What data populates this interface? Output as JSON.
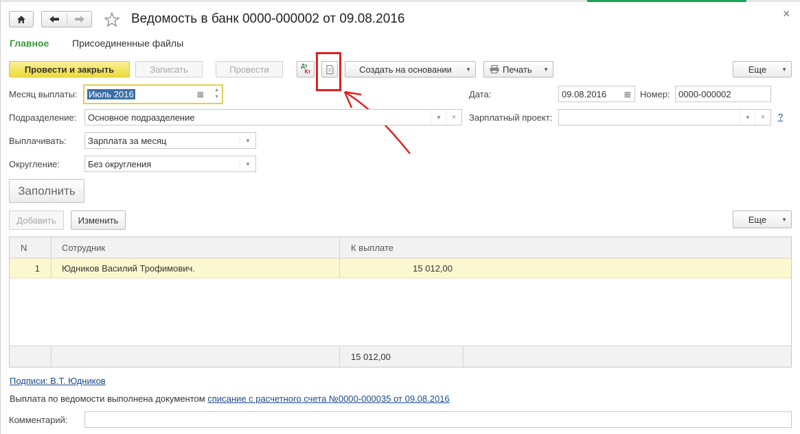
{
  "window": {
    "title": "Ведомость в банк 0000-000002 от 09.08.2016",
    "close_icon": "×"
  },
  "nav": {
    "home_icon": "home-icon",
    "back_icon": "arrow-left-icon",
    "forward_icon": "arrow-right-icon",
    "favorite_icon": "star-icon"
  },
  "tabs": {
    "main": "Главное",
    "files": "Присоединенные файлы"
  },
  "toolbar": {
    "post_close": "Провести и закрыть",
    "save": "Записать",
    "post": "Провести",
    "dtkt_top": "Дт",
    "dtkt_bottom": "Кт",
    "create_based": "Создать на основании",
    "print": "Печать",
    "more": "Еще"
  },
  "form": {
    "month_label": "Месяц выплаты:",
    "month_value": "Июль 2016",
    "date_label": "Дата:",
    "date_value": "09.08.2016",
    "number_label": "Номер:",
    "number_value": "0000-000002",
    "department_label": "Подразделение:",
    "department_value": "Основное подразделение",
    "salary_project_label": "Зарплатный проект:",
    "salary_project_value": "",
    "help": "?",
    "pay_label": "Выплачивать:",
    "pay_value": "Зарплата за месяц",
    "rounding_label": "Округление:",
    "rounding_value": "Без округления",
    "fill_button": "Заполнить"
  },
  "table_toolbar": {
    "add": "Добавить",
    "edit": "Изменить",
    "more": "Еще"
  },
  "table": {
    "columns": [
      "N",
      "Сотрудник",
      "К выплате"
    ],
    "rows": [
      {
        "n": "1",
        "employee": "Юдников Василий Трофимович.",
        "amount": "15 012,00"
      }
    ],
    "total": "15 012,00"
  },
  "footer": {
    "signatures_link": "Подписи: В.Т. Юдников",
    "payment_text": "Выплата по ведомости выполнена документом",
    "payment_link": "списание с расчетного счета №0000-000035 от 09.08.2016",
    "comment_label": "Комментарий:",
    "comment_value": ""
  },
  "colors": {
    "accent_green": "#1aa35b",
    "primary_button": "#eddb3a",
    "selected_row": "#fbf8d0",
    "annotation_red": "#e02020"
  }
}
